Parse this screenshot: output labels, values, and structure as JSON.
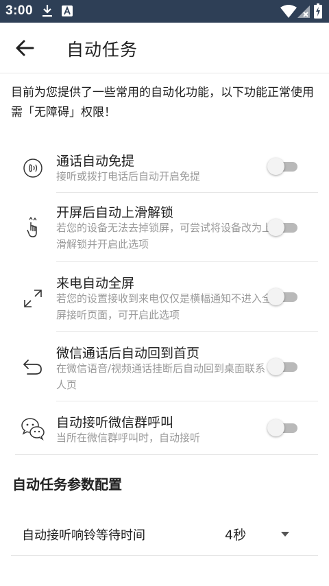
{
  "status_bar": {
    "time": "3:00"
  },
  "header": {
    "title": "自动任务"
  },
  "intro": "目前为您提供了一些常用的自动化功能，以下功能正常使用需「无障碍」权限！",
  "tasks": [
    {
      "title": "通话自动免提",
      "desc": "接听或拨打电话后自动开启免提",
      "icon": "speakerphone-icon",
      "enabled": false
    },
    {
      "title": "开屏后自动上滑解锁",
      "desc": "若您的设备无法去掉锁屏，可尝试将设备改为上滑解锁并开启此选项",
      "icon": "swipe-up-icon",
      "enabled": false
    },
    {
      "title": "来电自动全屏",
      "desc": "若您的设置接收到来电仅仅是横幅通知不进入全屏接听页面，可开启此选项",
      "icon": "fullscreen-icon",
      "enabled": false
    },
    {
      "title": "微信通话后自动回到首页",
      "desc": "在微信语音/视频通话挂断后自动回到桌面联系人页",
      "icon": "return-icon",
      "enabled": false
    },
    {
      "title": "自动接听微信群呼叫",
      "desc": "当所在微信群呼叫时，自动接听",
      "icon": "wechat-icon",
      "enabled": false
    }
  ],
  "config_section": {
    "title": "自动任务参数配置",
    "ring_wait": {
      "label": "自动接听响铃等待时间",
      "value": "4秒"
    }
  },
  "colors": {
    "status_bar": "#2e3f56",
    "switch_track": "#b9b9b9",
    "switch_thumb": "#f3f3f3",
    "secondary_text": "#9a9a9a"
  }
}
